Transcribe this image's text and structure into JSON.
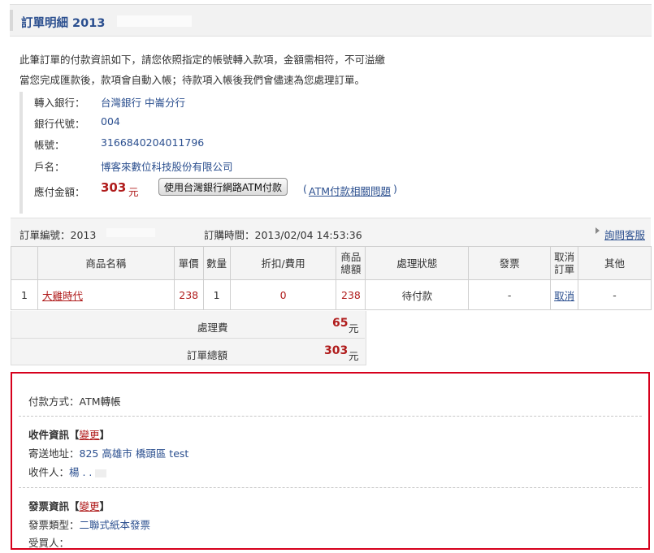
{
  "header": {
    "title": "訂單明細 2013"
  },
  "intro": {
    "line1": "此筆訂單的付款資訊如下，請您依照指定的帳號轉入款項，金額需相符，不可溢繳",
    "line2": "當您完成匯款後，款項會自動入帳；待款項入帳後我們會儘速為您處理訂單。"
  },
  "bank": {
    "bank_label": "轉入銀行：",
    "bank_value": "台灣銀行 中崙分行",
    "code_label": "銀行代號：",
    "code_value": "004",
    "account_label": "帳號：",
    "account_value": "3166840204011796",
    "holder_label": "戶名：",
    "holder_value": "博客來數位科技股份有限公司",
    "amount_label": "應付金額：",
    "amount_value": "303",
    "amount_unit": "元",
    "atm_button": "使用台灣銀行網路ATM付款",
    "atm_faq": "ATM付款相關問題",
    "paren_open": "(",
    "paren_close": ")"
  },
  "order": {
    "number_label": "訂單編號：2013",
    "time_label": "訂購時間：2013/02/04 14:53:36",
    "contact": "詢問客服",
    "columns": [
      "",
      "商品名稱",
      "單價",
      "數量",
      "折扣/費用",
      "商品\n總額",
      "處理狀態",
      "發票",
      "取消\n訂單",
      "其他"
    ],
    "row": {
      "index": "1",
      "name": "大雞時代",
      "price": "238",
      "qty": "1",
      "discount": "0",
      "total": "238",
      "status": "待付款",
      "invoice": "-",
      "cancel": "取消",
      "other": "-"
    },
    "fee_label": "處理費",
    "fee_value": "65",
    "fee_unit": "元",
    "sum_label": "訂單總額",
    "sum_value": "303",
    "sum_unit": "元"
  },
  "payment": {
    "method": "付款方式：ATM轉帳"
  },
  "recipient": {
    "title": "收件資訊",
    "bracket_open": "【",
    "bracket_close": "】",
    "edit": "變更",
    "address_label": "寄送地址：",
    "address_value": "825 高雄市 橋頭區 test",
    "name_label": "收件人：",
    "name_value": "楊 . ."
  },
  "invoice": {
    "title": "發票資訊",
    "bracket_open": "【",
    "bracket_close": "】",
    "edit": "變更",
    "type_label": "發票類型：",
    "type_value": "二聯式紙本發票",
    "buyer_label": "受買人："
  }
}
